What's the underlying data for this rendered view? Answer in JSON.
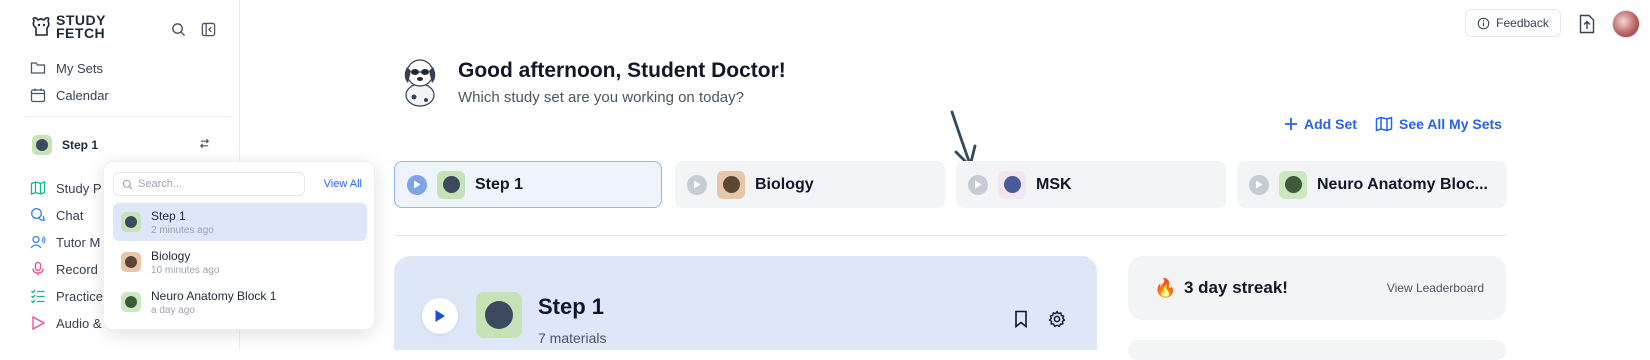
{
  "sidebar": {
    "logo_line1": "STUDY",
    "logo_line2": "FETCH",
    "nav": [
      {
        "label": "My Sets",
        "icon": "folder-icon"
      },
      {
        "label": "Calendar",
        "icon": "calendar-icon"
      }
    ],
    "current_set": "Step 1",
    "tools": [
      {
        "label": "Study P",
        "icon": "map-icon"
      },
      {
        "label": "Chat",
        "icon": "chat-icon"
      },
      {
        "label": "Tutor M",
        "icon": "tutor-icon"
      },
      {
        "label": "Record",
        "icon": "microphone-icon"
      },
      {
        "label": "Practice",
        "icon": "list-icon"
      },
      {
        "label": "Audio & Video",
        "icon": "play-icon"
      }
    ]
  },
  "dropdown": {
    "search_placeholder": "Search...",
    "view_all": "View All",
    "items": [
      {
        "name": "Step 1",
        "time": "2 minutes ago",
        "color": "#c5e3b6",
        "dot": "#3b4a5e"
      },
      {
        "name": "Biology",
        "time": "10 minutes ago",
        "color": "#e8c7a9",
        "dot": "#5a4633"
      },
      {
        "name": "Neuro Anatomy Block 1",
        "time": "a day ago",
        "color": "#cde8c0",
        "dot": "#3f5a3a"
      }
    ]
  },
  "header": {
    "feedback": "Feedback"
  },
  "greeting": {
    "title": "Good afternoon, Student Doctor!",
    "subtitle": "Which study set are you working on today?"
  },
  "actions": {
    "add_set": "Add Set",
    "see_all": "See All My Sets"
  },
  "sets": [
    {
      "label": "Step 1",
      "thumb": "#c5e3b6",
      "dot": "#3b4a5e",
      "active": true
    },
    {
      "label": "Biology",
      "thumb": "#e8c7a9",
      "dot": "#5a4633",
      "active": false
    },
    {
      "label": "MSK",
      "thumb": "#f4e6f0",
      "dot": "#4a5a9a",
      "active": false
    },
    {
      "label": "Neuro Anatomy Bloc...",
      "thumb": "#cde8c0",
      "dot": "#3f5a3a",
      "active": false
    }
  ],
  "featured": {
    "title": "Step 1",
    "materials": "7 materials"
  },
  "streak": {
    "text": "3 day streak!",
    "link": "View Leaderboard"
  },
  "colors": {
    "accent": "#2563eb",
    "active_bg": "#dde7f8",
    "card_bg": "#f3f4f6"
  }
}
